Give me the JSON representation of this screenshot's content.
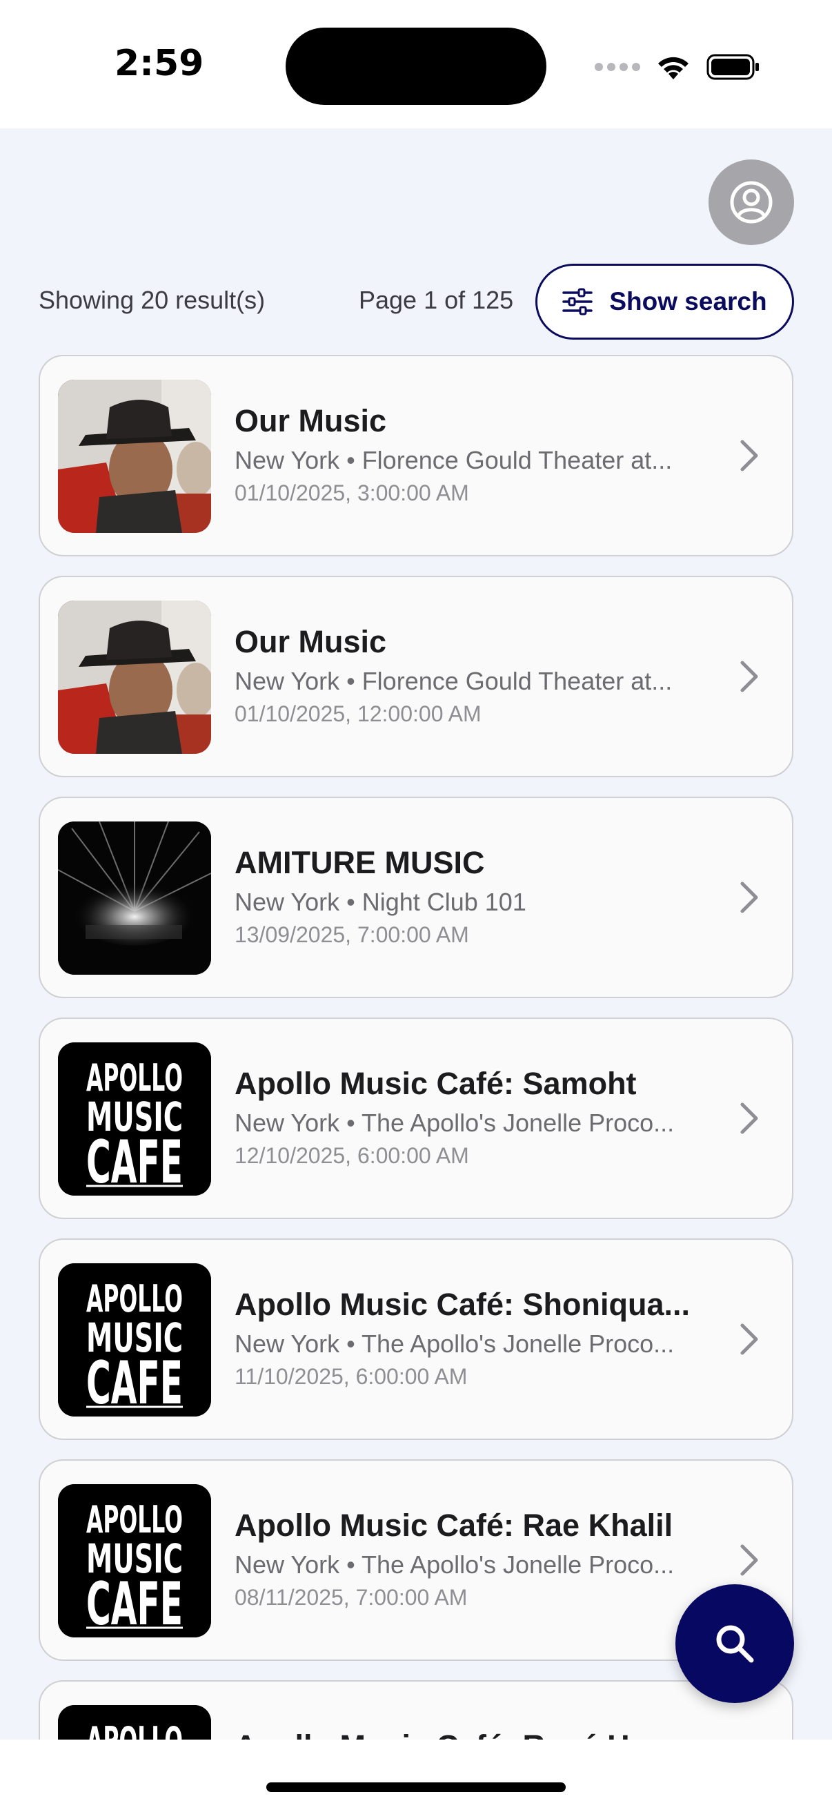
{
  "status_bar": {
    "time": "2:59"
  },
  "header": {
    "results_text": "Showing 20 result(s)",
    "page_text": "Page 1 of 125",
    "show_search_label": "Show search"
  },
  "events": [
    {
      "title": "Our Music",
      "subtitle": "New York • Florence Gould Theater at...",
      "date": "01/10/2025, 3:00:00 AM",
      "image": "man-in-hat-photo"
    },
    {
      "title": "Our Music",
      "subtitle": "New York • Florence Gould Theater at...",
      "date": "01/10/2025, 12:00:00 AM",
      "image": "man-in-hat-photo"
    },
    {
      "title": "AMITURE MUSIC",
      "subtitle": "New York • Night Club 101",
      "date": "13/09/2025, 7:00:00 AM",
      "image": "concert-lights-photo"
    },
    {
      "title": "Apollo Music Café: Samoht",
      "subtitle": "New York • The Apollo's Jonelle Proco...",
      "date": "12/10/2025, 6:00:00 AM",
      "image": "apollo-logo"
    },
    {
      "title": "Apollo Music Café: Shoniqua...",
      "subtitle": "New York • The Apollo's Jonelle Proco...",
      "date": "11/10/2025, 6:00:00 AM",
      "image": "apollo-logo"
    },
    {
      "title": "Apollo Music Café: Rae Khalil",
      "subtitle": "New York • The Apollo's Jonelle Proco...",
      "date": "08/11/2025, 7:00:00 AM",
      "image": "apollo-logo"
    },
    {
      "title": "Apollo Music Café: René H...",
      "subtitle": "",
      "date": "",
      "image": "apollo-logo"
    }
  ],
  "apollo_logo_text": [
    "APOLLO",
    "MUSIC",
    "CAFE"
  ],
  "colors": {
    "accent": "#0b0b5e",
    "fab": "#060862",
    "background": "#f1f4fb"
  }
}
